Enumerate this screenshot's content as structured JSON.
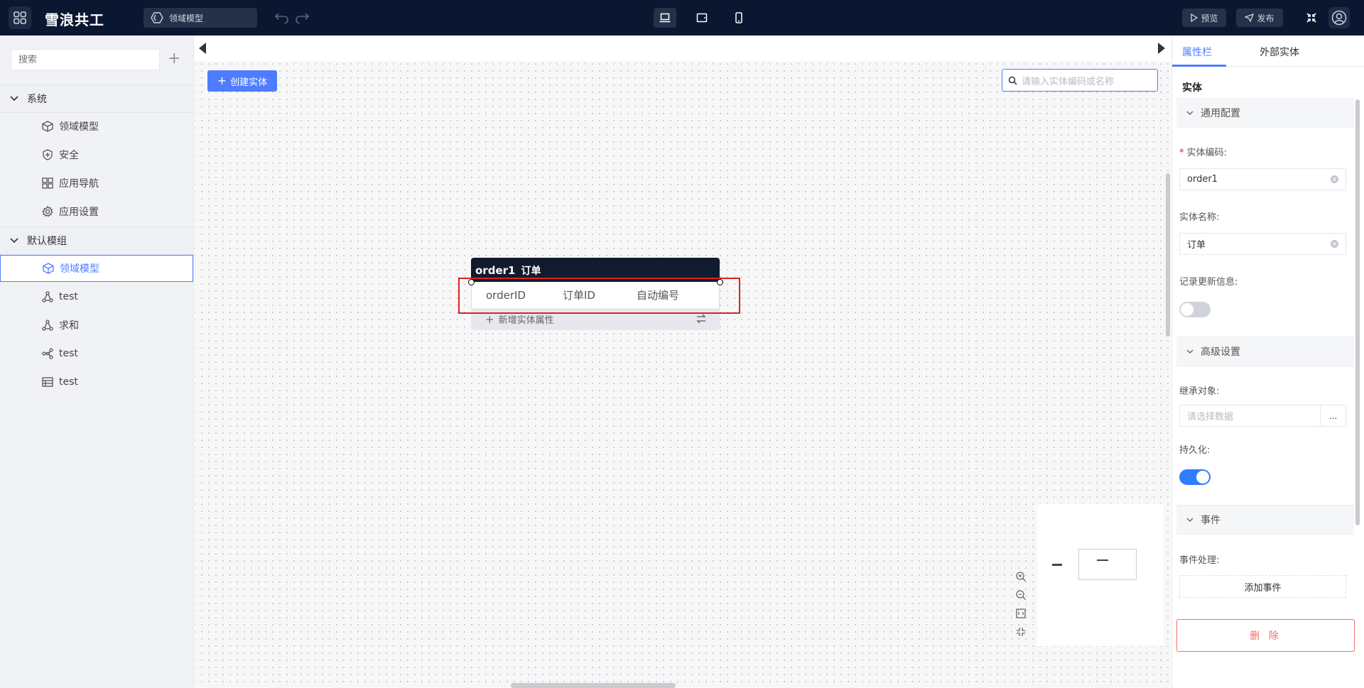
{
  "app": {
    "brand": "雪浪共工",
    "model_selector": "领域模型"
  },
  "header": {
    "preview_label": "预览",
    "publish_label": "发布",
    "device_buttons": [
      "desktop-icon",
      "tablet-icon",
      "mobile-icon"
    ],
    "active_device": "desktop-icon"
  },
  "sidebar": {
    "search_placeholder": "搜索",
    "groups": [
      {
        "label": "系统",
        "items": [
          {
            "label": "领域模型",
            "icon": "cube-icon"
          },
          {
            "label": "安全",
            "icon": "shield-icon"
          },
          {
            "label": "应用导航",
            "icon": "grid-icon"
          },
          {
            "label": "应用设置",
            "icon": "gear-icon"
          }
        ]
      },
      {
        "label": "默认模组",
        "items": [
          {
            "label": "领域模型",
            "icon": "cube-icon",
            "selected": true
          },
          {
            "label": "test",
            "icon": "triangle-flow-icon"
          },
          {
            "label": "求和",
            "icon": "triangle-flow-icon"
          },
          {
            "label": "test",
            "icon": "flow-nodes-icon"
          },
          {
            "label": "test",
            "icon": "table-icon"
          }
        ]
      }
    ]
  },
  "canvas": {
    "create_label": "创建实体",
    "search_placeholder": "请输入实体编码或名称",
    "entity": {
      "code": "order1",
      "name": "订单",
      "attributes": [
        {
          "code": "orderID",
          "name": "订单ID",
          "type": "自动编号"
        }
      ],
      "add_attr_label": "新增实体属性"
    }
  },
  "panel": {
    "tabs": [
      "属性栏",
      "外部实体"
    ],
    "active_tab": "属性栏",
    "title": "实体",
    "sections": {
      "general": "通用配置",
      "advanced": "高级设置",
      "events": "事件"
    },
    "fields": {
      "entity_code_label": "实体编码:",
      "entity_code_value": "order1",
      "entity_name_label": "实体名称:",
      "entity_name_value": "订单",
      "record_update_label": "记录更新信息:",
      "record_update_on": false,
      "inherit_label": "继承对象:",
      "inherit_placeholder": "请选择数据",
      "inherit_more": "...",
      "persist_label": "持久化:",
      "persist_on": true,
      "event_handle_label": "事件处理:",
      "add_event_label": "添加事件"
    },
    "delete_label": "删 除",
    "colors": {
      "accent": "#4f7cff",
      "danger": "#f56c6c",
      "topbar": "#0b1730"
    }
  }
}
